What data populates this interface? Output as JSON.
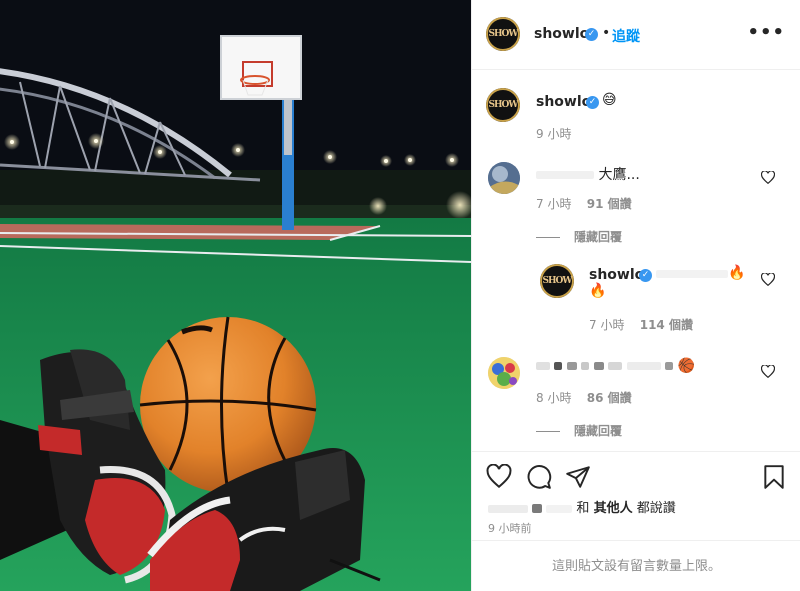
{
  "header": {
    "username": "showlo",
    "verified": true,
    "separator": "•",
    "follow_label": "追蹤",
    "more_icon": "more-horizontal-icon",
    "avatar_text": "SHOW"
  },
  "caption": {
    "username": "showlo",
    "emoji": "😅",
    "time": "9 小時"
  },
  "comments": [
    {
      "username_blurred": true,
      "text": "大鷹...",
      "time": "7 小時",
      "likes": "91 個讚",
      "view_replies": "隱藏回覆",
      "replies": [
        {
          "username": "showlo",
          "verified": true,
          "emoji_inline": "🔥",
          "emoji_next_line": "🔥",
          "time": "7 小時",
          "likes": "114 個讚"
        }
      ]
    },
    {
      "username_blurred": true,
      "emoji": "🏀",
      "time": "8 小時",
      "likes": "86 個讚",
      "view_replies": "隱藏回覆"
    }
  ],
  "actions": {
    "icons": [
      "heart-icon",
      "comment-icon",
      "share-icon",
      "bookmark-icon"
    ]
  },
  "likes_line": {
    "and": "和",
    "others": "其他人",
    "suffix": "都說讚"
  },
  "post_time": "9 小時前",
  "footer_text": "這則貼文設有留言數量上限。",
  "colors": {
    "link_blue": "#0095f6",
    "verified_blue": "#3897f0",
    "meta_gray": "#8e8e8e",
    "court_green": "#1f9c55",
    "court_red": "#b86a5c",
    "ball_orange": "#e8892f",
    "pole_blue": "#2a7fd0",
    "sky": "#0a0d14"
  }
}
